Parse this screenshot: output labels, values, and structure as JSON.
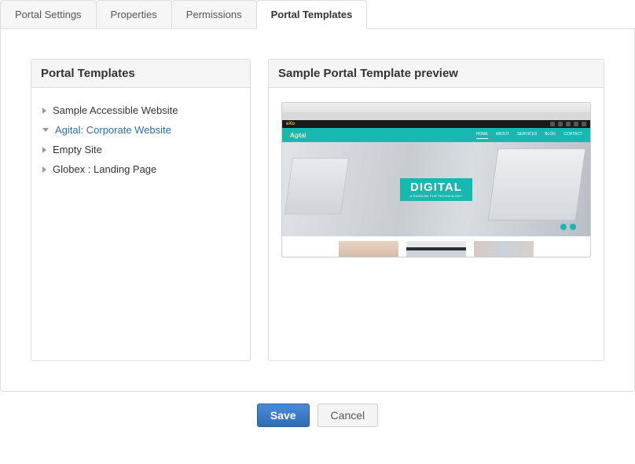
{
  "tabs": [
    {
      "label": "Portal Settings",
      "active": false
    },
    {
      "label": "Properties",
      "active": false
    },
    {
      "label": "Permissions",
      "active": false
    },
    {
      "label": "Portal Templates",
      "active": true
    }
  ],
  "left_panel": {
    "title": "Portal Templates",
    "templates": [
      {
        "label": "Sample Accessible Website",
        "selected": false
      },
      {
        "label": "Agital: Corporate Website",
        "selected": true
      },
      {
        "label": "Empty Site",
        "selected": false
      },
      {
        "label": "Globex : Landing Page",
        "selected": false
      }
    ]
  },
  "right_panel": {
    "title": "Sample Portal Template preview",
    "preview": {
      "brand_prefix": "A",
      "brand_rest": "gital",
      "nav_items": [
        "HOME",
        "ABOUT",
        "SERVICES",
        "BLOG",
        "CONTACT"
      ],
      "hero_title": "DIGITAL",
      "hero_subtitle": "A PASSION FOR TECHNOLOGY",
      "exo_label": "eXo"
    }
  },
  "footer": {
    "save_label": "Save",
    "cancel_label": "Cancel"
  }
}
